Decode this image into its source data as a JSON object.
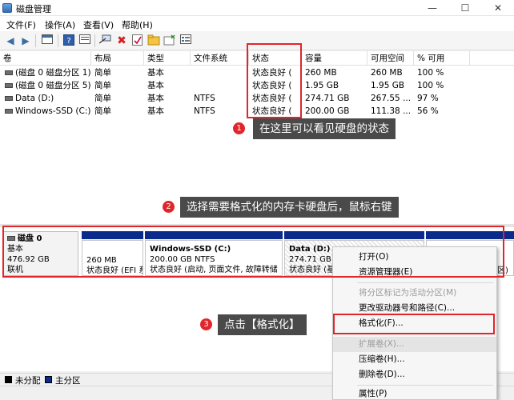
{
  "window": {
    "title": "磁盘管理",
    "min_glyph": "—",
    "max_glyph": "☐",
    "close_glyph": "✕"
  },
  "menu": [
    "文件(F)",
    "操作(A)",
    "查看(V)",
    "帮助(H)"
  ],
  "toolbar_icons": [
    "back-arrow-icon",
    "forward-arrow-icon",
    "console-icon",
    "help-icon",
    "properties-icon",
    "connect-icon",
    "delete-icon",
    "check-icon",
    "folder-icon",
    "list-icon"
  ],
  "volume_columns": [
    "卷",
    "布局",
    "类型",
    "文件系统",
    "状态",
    "容量",
    "可用空间",
    "% 可用"
  ],
  "volumes": [
    {
      "name": "(磁盘 0 磁盘分区 1)",
      "layout": "简单",
      "type": "基本",
      "fs": "",
      "status": "状态良好 (",
      "capacity": "260 MB",
      "free": "260 MB",
      "pct": "100 %"
    },
    {
      "name": "(磁盘 0 磁盘分区 5)",
      "layout": "简单",
      "type": "基本",
      "fs": "",
      "status": "状态良好 (",
      "capacity": "1.95 GB",
      "free": "1.95 GB",
      "pct": "100 %"
    },
    {
      "name": "Data (D:)",
      "layout": "简单",
      "type": "基本",
      "fs": "NTFS",
      "status": "状态良好 (",
      "capacity": "274.71 GB",
      "free": "267.55 ...",
      "pct": "97 %"
    },
    {
      "name": "Windows-SSD (C:)",
      "layout": "简单",
      "type": "基本",
      "fs": "NTFS",
      "status": "状态良好 (",
      "capacity": "200.00 GB",
      "free": "111.38 ...",
      "pct": "56 %"
    }
  ],
  "disk": {
    "name": "磁盘 0",
    "type": "基本",
    "size": "476.92 GB",
    "state": "联机"
  },
  "partitions": [
    {
      "title": "",
      "line1": "260 MB",
      "line2": "状态良好 (EFI 系"
    },
    {
      "title": "Windows-SSD  (C:)",
      "line1": "200.00 GB NTFS",
      "line2": "状态良好 (启动, 页面文件, 故障转储"
    },
    {
      "title": "Data  (D:)",
      "line1": "274.71 GB",
      "line2": "状态良好 (基"
    },
    {
      "title": "",
      "line1": "",
      "line2": "区)"
    }
  ],
  "context_menu": [
    {
      "label": "打开(O)",
      "disabled": false
    },
    {
      "label": "资源管理器(E)",
      "disabled": false
    },
    {
      "label": "将分区标记为活动分区(M)",
      "disabled": true
    },
    {
      "label": "更改驱动器号和路径(C)...",
      "disabled": false
    },
    {
      "label": "格式化(F)...",
      "disabled": false
    },
    {
      "label": "扩展卷(X)...",
      "disabled": true
    },
    {
      "label": "压缩卷(H)...",
      "disabled": false
    },
    {
      "label": "删除卷(D)...",
      "disabled": false
    },
    {
      "label": "属性(P)",
      "disabled": false
    }
  ],
  "legend": [
    {
      "label": "未分配",
      "color": "#000000"
    },
    {
      "label": "主分区",
      "color": "#0a2a8c"
    }
  ],
  "annotations": [
    {
      "num": "1",
      "text": "在这里可以看见硬盘的状态"
    },
    {
      "num": "2",
      "text": "选择需要格式化的内存卡硬盘后，鼠标右键"
    },
    {
      "num": "3",
      "text": "点击【格式化】"
    }
  ],
  "colors": {
    "accent_red": "#e0252b",
    "partition_bar": "#0a2a8c",
    "callout_bg": "#4a4a4a"
  }
}
